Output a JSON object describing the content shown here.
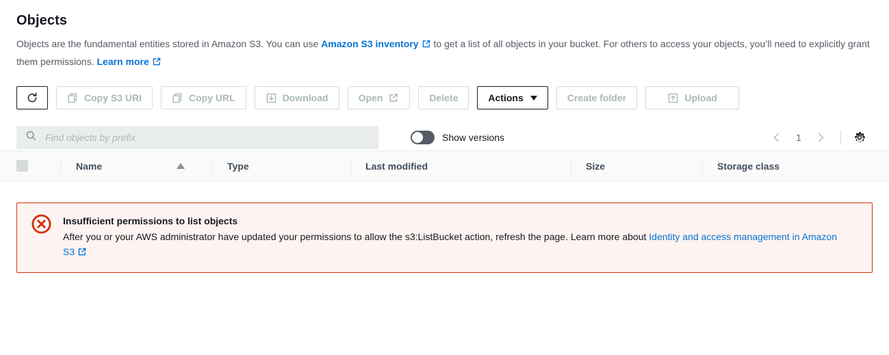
{
  "header": {
    "title": "Objects",
    "desc_part1": "Objects are the fundamental entities stored in Amazon S3. You can use ",
    "inventory_link": "Amazon S3 inventory",
    "desc_part2": " to get a list of all objects in your bucket. For others to access your objects, you’ll need to explicitly grant them permissions. ",
    "learn_more_link": "Learn more"
  },
  "toolbar": {
    "refresh_icon": "refresh-icon",
    "copy_s3_uri_label": "Copy S3 URI",
    "copy_url_label": "Copy URL",
    "download_label": "Download",
    "open_label": "Open",
    "delete_label": "Delete",
    "actions_label": "Actions",
    "create_folder_label": "Create folder",
    "upload_label": "Upload"
  },
  "filter": {
    "search_placeholder": "Find objects by prefix",
    "search_value": "",
    "show_versions_label": "Show versions",
    "show_versions_state": "off",
    "page_number": "1",
    "prev_icon": "chevron-left-icon",
    "next_icon": "chevron-right-icon",
    "settings_icon": "gear-icon"
  },
  "table": {
    "columns": [
      {
        "label": "Name",
        "sorted": "ascending"
      },
      {
        "label": "Type",
        "sorted": ""
      },
      {
        "label": "Last modified",
        "sorted": ""
      },
      {
        "label": "Size",
        "sorted": ""
      },
      {
        "label": "Storage class",
        "sorted": ""
      }
    ]
  },
  "alert": {
    "type": "error",
    "icon": "error-circle-x-icon",
    "title": "Insufficient permissions to list objects",
    "text": "After you or your AWS administrator have updated your permissions to allow the s3:ListBucket action, refresh the page. Learn more about ",
    "link": "Identity and access management in Amazon S3"
  },
  "colors": {
    "link": "#0972d3",
    "error_border": "#d13212",
    "error_bg": "#fdf3f1",
    "disabled_text": "#aab7b8",
    "text": "#16191f",
    "secondary_text": "#545b64"
  }
}
